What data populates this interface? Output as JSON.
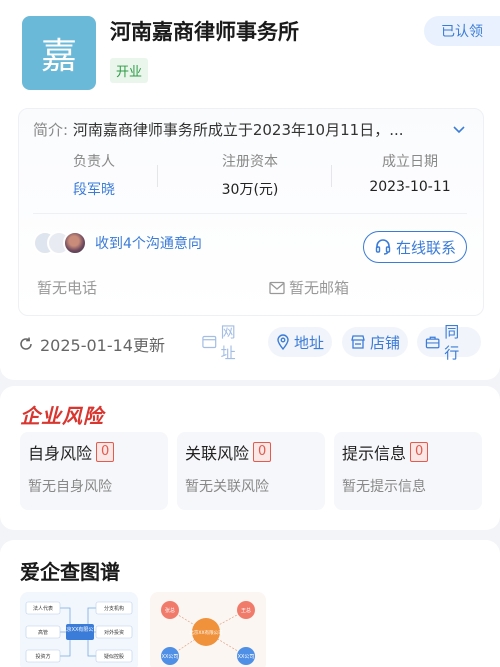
{
  "company": {
    "logo_char": "嘉",
    "name": "河南嘉商律师事务所",
    "status": "开业",
    "verified": "已认领"
  },
  "info": {
    "intro_label": "简介:",
    "intro_text": "河南嘉商律师事务所成立于2023年10月11日，...",
    "stats": [
      {
        "label": "负责人",
        "value": "段军晓"
      },
      {
        "label": "注册资本",
        "value": "30万(元)"
      },
      {
        "label": "成立日期",
        "value": "2023-10-11"
      }
    ],
    "contact_text": "收到4个沟通意向",
    "online_button": "在线联系",
    "no_phone": "暂无电话",
    "no_email": "暂无邮箱"
  },
  "toolbar": {
    "updated": "2025-01-14更新",
    "website": "网址",
    "address": "地址",
    "store": "店铺",
    "peer": "同行"
  },
  "risk": {
    "title": "企业风险",
    "boxes": [
      {
        "title": "自身风险",
        "count": "0",
        "desc": "暂无自身风险"
      },
      {
        "title": "关联风险",
        "count": "0",
        "desc": "暂无关联风险"
      },
      {
        "title": "提示信息",
        "count": "0",
        "desc": "暂无提示信息"
      }
    ]
  },
  "map": {
    "title": "爱企查图谱",
    "thumb1": {
      "center": "北京XX有限公司",
      "nodes": [
        "法人代表",
        "分支机构",
        "高管",
        "对外投资",
        "投资方",
        "疑似控股"
      ]
    },
    "thumb2": {
      "center": "北京XX有限公司",
      "nodes": [
        "张总",
        "王总",
        "XX公司",
        "XX公司"
      ]
    }
  },
  "colors": {
    "accent": "#3b7cd8",
    "logo_bg": "#6bb9d8",
    "risk_red": "#d8362f",
    "status_green": "#2e9b46"
  }
}
